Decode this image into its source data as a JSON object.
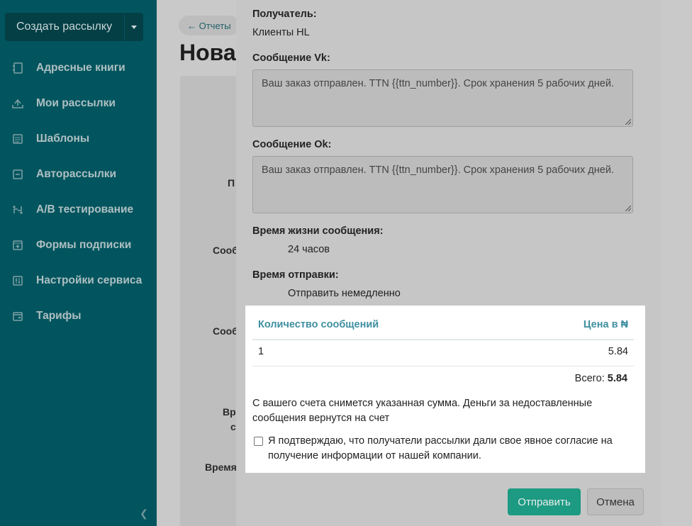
{
  "sidebar": {
    "create_button": "Создать рассылку",
    "items": [
      {
        "label": "Адресные книги",
        "icon": "address-book-icon"
      },
      {
        "label": "Мои рассылки",
        "icon": "mailings-icon"
      },
      {
        "label": "Шаблоны",
        "icon": "templates-icon"
      },
      {
        "label": "Авторассылки",
        "icon": "automation-icon"
      },
      {
        "label": "A/B тестирование",
        "icon": "ab-test-icon"
      },
      {
        "label": "Формы подписки",
        "icon": "subscription-form-icon"
      },
      {
        "label": "Настройки сервиса",
        "icon": "settings-icon"
      },
      {
        "label": "Тарифы",
        "icon": "tariffs-icon"
      }
    ]
  },
  "background": {
    "back_link": "← Отчеты",
    "page_title": "Нова",
    "labels": [
      "П",
      "Сооб",
      "Сооб",
      "Вр",
      "с",
      "Время"
    ]
  },
  "modal": {
    "recipient_label": "Получатель:",
    "recipient_value": "Клиенты HL",
    "vk_label": "Сообщение Vk:",
    "vk_message": "Ваш заказ отправлен. TTN {{ttn_number}}. Срок хранения 5 рабочих дней.",
    "ok_label": "Сообщение Ok:",
    "ok_message": "Ваш заказ отправлен. TTN {{ttn_number}}. Срок хранения 5 рабочих дней.",
    "lifetime_label": "Время жизни сообщения:",
    "lifetime_value": "24 часов",
    "send_time_label": "Время отправки:",
    "send_time_value": "Отправить немедленно",
    "table": {
      "col_qty": "Количество сообщений",
      "col_price": "Цена в ₦",
      "qty": "1",
      "price": "5.84"
    },
    "total_label": "Всего:",
    "total_value": "5.84",
    "note": "С вашего счета снимется указанная сумма. Деньги за недоставленные сообщения вернутся на счет",
    "consent": "Я подтверждаю, что получатели рассылки дали свое явное согласие на получение информации от нашей компании.",
    "send_button": "Отправить",
    "cancel_button": "Отмена"
  },
  "colors": {
    "sidebar": "#02555e",
    "accent": "#1d9a82",
    "table_header": "#3f8fa0"
  }
}
